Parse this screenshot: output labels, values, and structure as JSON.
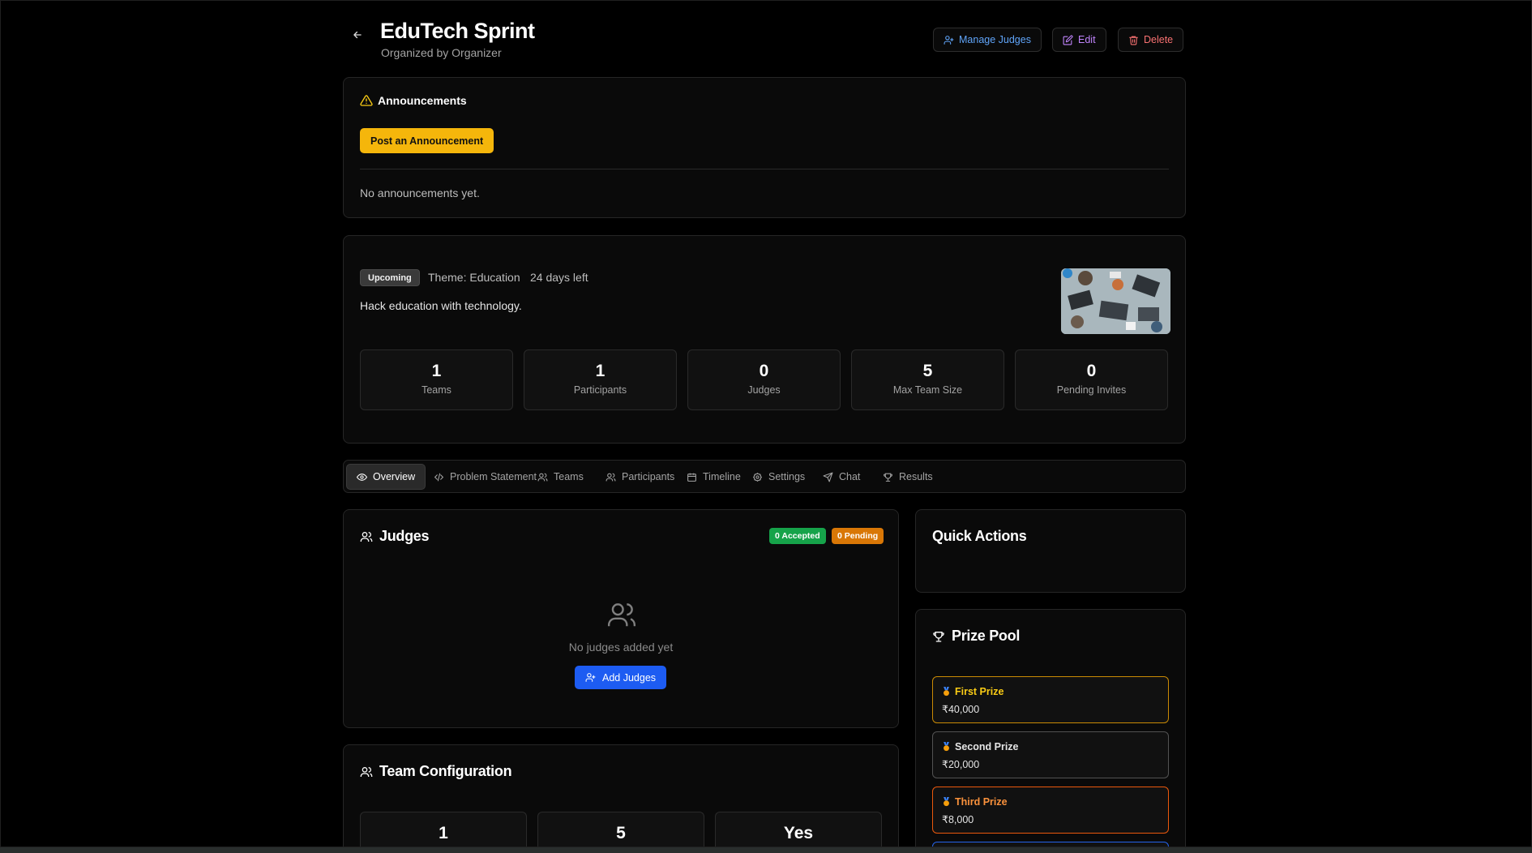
{
  "header": {
    "title": "EduTech Sprint",
    "subtitle": "Organized by Organizer",
    "manage_judges": "Manage Judges",
    "edit": "Edit",
    "delete": "Delete"
  },
  "announcements": {
    "title": "Announcements",
    "post_button": "Post an Announcement",
    "empty_text": "No announcements yet."
  },
  "event": {
    "status": "Upcoming",
    "theme": "Theme: Education",
    "days_left": "24 days left",
    "description": "Hack education with technology.",
    "stats": [
      {
        "value": "1",
        "label": "Teams"
      },
      {
        "value": "1",
        "label": "Participants"
      },
      {
        "value": "0",
        "label": "Judges"
      },
      {
        "value": "5",
        "label": "Max Team Size"
      },
      {
        "value": "0",
        "label": "Pending Invites"
      }
    ]
  },
  "tabs": [
    {
      "label": "Overview",
      "icon": "eye-icon"
    },
    {
      "label": "Problem Statement",
      "icon": "code-icon"
    },
    {
      "label": "Teams",
      "icon": "users-icon"
    },
    {
      "label": "Participants",
      "icon": "users-icon"
    },
    {
      "label": "Timeline",
      "icon": "calendar-icon"
    },
    {
      "label": "Settings",
      "icon": "gear-icon"
    },
    {
      "label": "Chat",
      "icon": "send-icon"
    },
    {
      "label": "Results",
      "icon": "trophy-icon"
    }
  ],
  "judges": {
    "title": "Judges",
    "accepted": "0 Accepted",
    "pending": "0 Pending",
    "empty_text": "No judges added yet",
    "add_button": "Add Judges"
  },
  "team_config": {
    "title": "Team Configuration",
    "values": [
      "1",
      "5",
      "Yes"
    ]
  },
  "quick_actions": {
    "title": "Quick Actions"
  },
  "prize_pool": {
    "title": "Prize Pool",
    "prizes": [
      {
        "name": "First Prize",
        "amount": "₹40,000",
        "color": "#facc15",
        "border": "#ca8a04"
      },
      {
        "name": "Second Prize",
        "amount": "₹20,000",
        "color": "#e5e5e5",
        "border": "#525252"
      },
      {
        "name": "Third Prize",
        "amount": "₹8,000",
        "color": "#fb923c",
        "border": "#ea580c"
      }
    ]
  },
  "colors": {
    "accent_yellow": "#f5b60b",
    "accent_blue": "#1d5cf2",
    "accepted_green": "#16a34a",
    "pending_orange": "#d97706"
  }
}
